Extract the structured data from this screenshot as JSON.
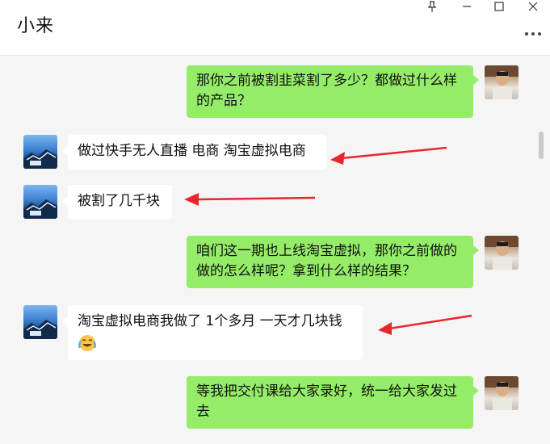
{
  "header": {
    "title": "小来"
  },
  "messages": [
    {
      "side": "self",
      "lines": [
        "那你之前被割韭菜割了多少？都做过什么样",
        "的产品？"
      ]
    },
    {
      "side": "other",
      "text": "做过快手无人直播 电商  淘宝虚拟电商"
    },
    {
      "side": "other",
      "text": "被割了几千块"
    },
    {
      "side": "self",
      "lines": [
        "咱们这一期也上线淘宝虚拟，那你之前做的",
        "做的怎么样呢？拿到什么样的结果？"
      ]
    },
    {
      "side": "other",
      "line1": "淘宝虚拟电商我做了 1个多月  一天才几块钱"
    },
    {
      "side": "self",
      "lines": [
        "等我把交付课给大家录好，统一给大家发过",
        "去"
      ]
    }
  ],
  "icons": {
    "pin": "pin-icon",
    "minimize": "minimize-icon",
    "maximize": "maximize-icon",
    "close": "close-icon",
    "more": "more-icon",
    "emoji": "crying-laughing-emoji"
  },
  "colors": {
    "self_bubble": "#95ec69",
    "other_bubble": "#ffffff",
    "chat_bg": "#f5f5f5",
    "annotation_arrow": "#e8262b"
  }
}
